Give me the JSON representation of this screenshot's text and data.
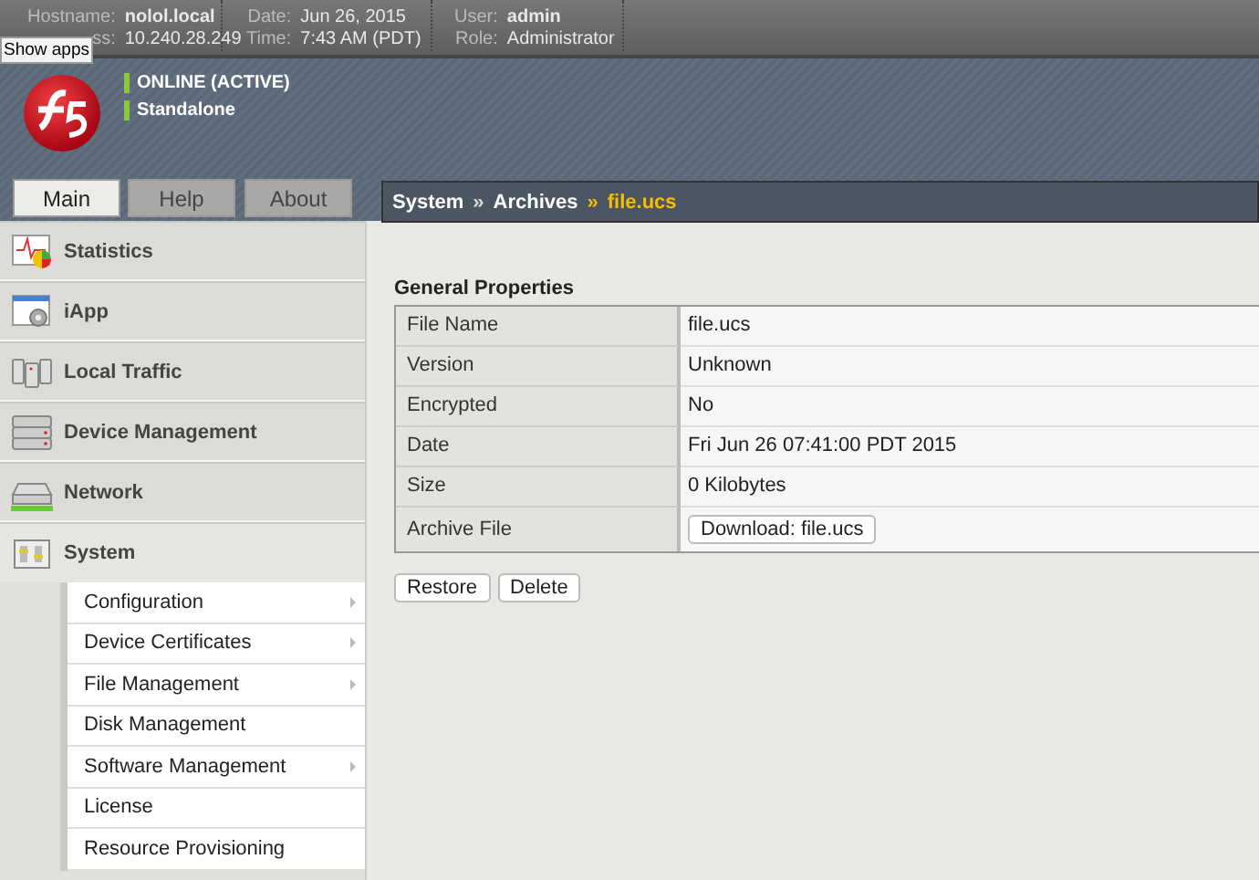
{
  "top_bar": {
    "groups": [
      {
        "fields": [
          {
            "label": "Hostname:",
            "value": "nolol.local"
          },
          {
            "label": "ss:",
            "value": "10.240.28.249"
          }
        ]
      },
      {
        "fields": [
          {
            "label": "Date:",
            "value": "Jun 26, 2015"
          },
          {
            "label": "Time:",
            "value": "7:43 AM (PDT)"
          }
        ]
      },
      {
        "fields": [
          {
            "label": "User:",
            "value": "admin"
          },
          {
            "label": "Role:",
            "value": "Administrator"
          }
        ]
      }
    ]
  },
  "tooltip": "Show apps",
  "status": [
    {
      "text": "ONLINE (ACTIVE)",
      "color": "#8cc63f"
    },
    {
      "text": "Standalone",
      "color": "#8cc63f"
    }
  ],
  "tabs": [
    {
      "label": "Main",
      "selected": true
    },
    {
      "label": "Help",
      "selected": false
    },
    {
      "label": "About",
      "selected": false
    }
  ],
  "breadcrumb": [
    {
      "text": "System",
      "current": false
    },
    {
      "text": "Archives",
      "current": false
    },
    {
      "text": "file.ucs",
      "current": true
    }
  ],
  "breadcrumb_separator": "»",
  "sidebar": {
    "items": [
      {
        "label": "Statistics",
        "kind": "statistics",
        "expanded": false
      },
      {
        "label": "iApp",
        "kind": "iapp",
        "expanded": false
      },
      {
        "label": "Local Traffic",
        "kind": "traffic",
        "expanded": false
      },
      {
        "label": "Device Management",
        "kind": "device",
        "expanded": false
      },
      {
        "label": "Network",
        "kind": "network",
        "expanded": false
      },
      {
        "label": "System",
        "kind": "system",
        "expanded": true,
        "children": [
          {
            "label": "Configuration",
            "has_submenu": true
          },
          {
            "label": "Device Certificates",
            "has_submenu": true
          },
          {
            "label": "File Management",
            "has_submenu": true
          },
          {
            "label": "Disk Management",
            "has_submenu": false
          },
          {
            "label": "Software Management",
            "has_submenu": true
          },
          {
            "label": "License",
            "has_submenu": false
          },
          {
            "label": "Resource Provisioning",
            "has_submenu": false
          }
        ]
      }
    ]
  },
  "section_title": "General Properties",
  "properties": [
    {
      "label": "File Name",
      "value": "file.ucs",
      "kind": "text"
    },
    {
      "label": "Version",
      "value": "Unknown",
      "kind": "text"
    },
    {
      "label": "Encrypted",
      "value": "No",
      "kind": "text"
    },
    {
      "label": "Date",
      "value": "Fri Jun 26 07:41:00 PDT 2015",
      "kind": "text"
    },
    {
      "label": "Size",
      "value": "0 Kilobytes",
      "kind": "text"
    },
    {
      "label": "Archive File",
      "value": "Download: file.ucs",
      "kind": "button"
    }
  ],
  "buttons": [
    "Restore",
    "Delete"
  ]
}
